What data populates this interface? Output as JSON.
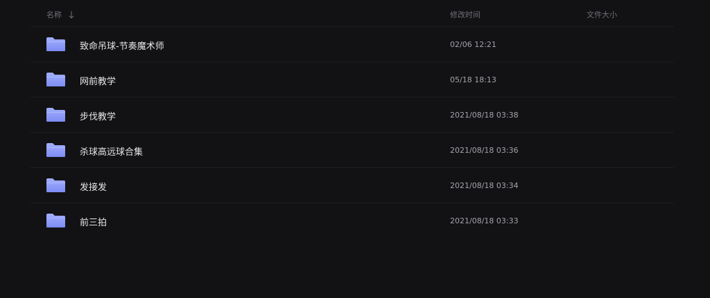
{
  "header": {
    "name_label": "名称",
    "sort_icon": "arrow-down-icon",
    "time_label": "修改时间",
    "size_label": "文件大小"
  },
  "accent": {
    "folder_top": "#9aa8ff",
    "folder_bottom": "#7f8ef5"
  },
  "files": [
    {
      "icon": "folder-icon",
      "name": "致命吊球-节奏魔术师",
      "time": "02/06 12:21",
      "size": ""
    },
    {
      "icon": "folder-icon",
      "name": "网前教学",
      "time": "05/18 18:13",
      "size": ""
    },
    {
      "icon": "folder-icon",
      "name": "步伐教学",
      "time": "2021/08/18 03:38",
      "size": ""
    },
    {
      "icon": "folder-icon",
      "name": "杀球高远球合集",
      "time": "2021/08/18 03:36",
      "size": ""
    },
    {
      "icon": "folder-icon",
      "name": "发接发",
      "time": "2021/08/18 03:34",
      "size": ""
    },
    {
      "icon": "folder-icon",
      "name": "前三拍",
      "time": "2021/08/18 03:33",
      "size": ""
    }
  ]
}
